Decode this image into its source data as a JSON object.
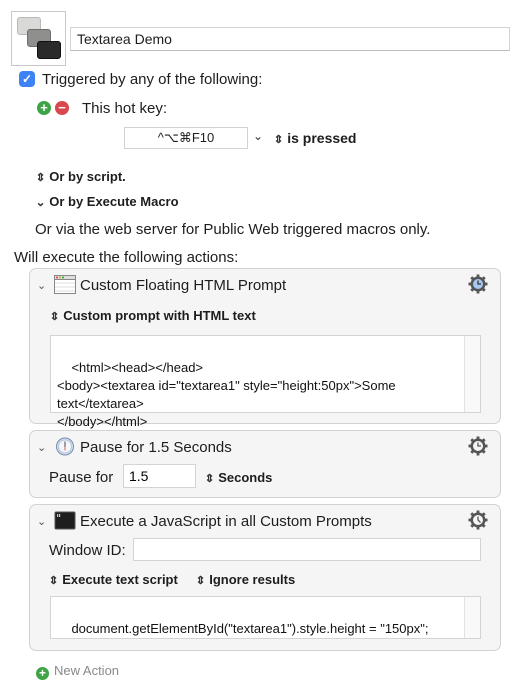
{
  "macro": {
    "name": "Textarea Demo",
    "icon": "keyboard-keys-icon"
  },
  "trigger": {
    "checked": true,
    "label": "Triggered by any of the following:",
    "add_icon": "plus-circle-icon",
    "remove_icon": "minus-circle-icon",
    "hotkey_label": "This hot key:",
    "hotkey_value": "^⌥⌘F10",
    "hotkey_dropdown_glyph": "⌄",
    "hotkey_state": "is pressed",
    "stepper_glyph": "⌃⌄",
    "script_label": "Or by script.",
    "execute_macro_label": "Or by Execute Macro",
    "web_server_text": "Or via the web server for Public Web triggered macros only."
  },
  "actions_heading": "Will execute the following actions:",
  "actions": [
    {
      "title": "Custom Floating HTML Prompt",
      "icon": "window-icon",
      "mode": "Custom prompt with HTML text",
      "code": "<html><head></head>\n<body><textarea id=\"textarea1\" style=\"height:50px\">Some\ntext</textarea>\n</body></html>"
    },
    {
      "title": "Pause for 1.5 Seconds",
      "icon": "clock-icon",
      "field_label": "Pause for",
      "field_value": "1.5",
      "unit": "Seconds"
    },
    {
      "title": "Execute a JavaScript in all Custom Prompts",
      "icon": "terminal-icon",
      "window_id_label": "Window ID:",
      "window_id_value": "",
      "mode": "Execute text script",
      "results": "Ignore results",
      "code": "document.getElementById(\"textarea1\").style.height = \"150px\";"
    }
  ],
  "new_action_label": "New Action",
  "colors": {
    "checkbox": "#3d82f6",
    "add": "#3fa447",
    "remove": "#d9464e",
    "gear": "#555555",
    "gear_clock": "#a9c8ee"
  }
}
